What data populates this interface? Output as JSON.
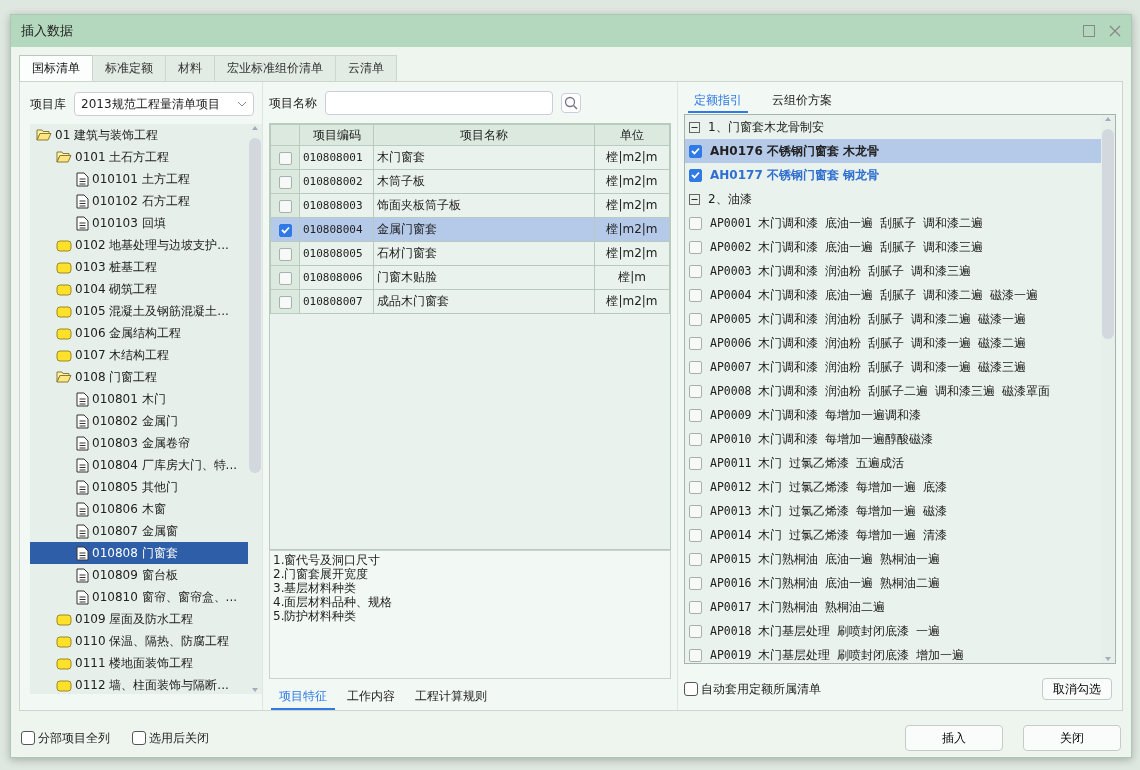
{
  "window": {
    "title": "插入数据"
  },
  "tabs": [
    {
      "label": "国标清单",
      "selected": true
    },
    {
      "label": "标准定额",
      "selected": false
    },
    {
      "label": "材料",
      "selected": false
    },
    {
      "label": "宏业标准组价清单",
      "selected": false
    },
    {
      "label": "云清单",
      "selected": false
    }
  ],
  "library": {
    "label": "项目库",
    "value": "2013规范工程量清单项目"
  },
  "tree": [
    {
      "label": "01 建筑与装饰工程",
      "kind": "folder",
      "expanded": true,
      "selected": false,
      "children": [
        {
          "label": "0101 土石方工程",
          "kind": "folder",
          "expanded": true,
          "selected": false,
          "children": [
            {
              "label": "010101 土方工程",
              "kind": "doc",
              "selected": false
            },
            {
              "label": "010102 石方工程",
              "kind": "doc",
              "selected": false
            },
            {
              "label": "010103 回填",
              "kind": "doc",
              "selected": false
            }
          ]
        },
        {
          "label": "0102 地基处理与边坡支护...",
          "kind": "folder",
          "expanded": false,
          "selected": false
        },
        {
          "label": "0103 桩基工程",
          "kind": "folder",
          "expanded": false,
          "selected": false
        },
        {
          "label": "0104 砌筑工程",
          "kind": "folder",
          "expanded": false,
          "selected": false
        },
        {
          "label": "0105 混凝土及钢筋混凝土...",
          "kind": "folder",
          "expanded": false,
          "selected": false
        },
        {
          "label": "0106 金属结构工程",
          "kind": "folder",
          "expanded": false,
          "selected": false
        },
        {
          "label": "0107 木结构工程",
          "kind": "folder",
          "expanded": false,
          "selected": false
        },
        {
          "label": "0108 门窗工程",
          "kind": "folder",
          "expanded": true,
          "selected": false,
          "children": [
            {
              "label": "010801 木门",
              "kind": "doc",
              "selected": false
            },
            {
              "label": "010802 金属门",
              "kind": "doc",
              "selected": false
            },
            {
              "label": "010803 金属卷帘",
              "kind": "doc",
              "selected": false
            },
            {
              "label": "010804 厂库房大门、特...",
              "kind": "doc",
              "selected": false
            },
            {
              "label": "010805 其他门",
              "kind": "doc",
              "selected": false
            },
            {
              "label": "010806 木窗",
              "kind": "doc",
              "selected": false
            },
            {
              "label": "010807 金属窗",
              "kind": "doc",
              "selected": false
            },
            {
              "label": "010808 门窗套",
              "kind": "doc",
              "selected": true
            },
            {
              "label": "010809 窗台板",
              "kind": "doc",
              "selected": false
            },
            {
              "label": "010810 窗帘、窗帘盒、...",
              "kind": "doc",
              "selected": false
            }
          ]
        },
        {
          "label": "0109 屋面及防水工程",
          "kind": "folder",
          "expanded": false,
          "selected": false
        },
        {
          "label": "0110 保温、隔热、防腐工程",
          "kind": "folder",
          "expanded": false,
          "selected": false
        },
        {
          "label": "0111 楼地面装饰工程",
          "kind": "folder",
          "expanded": false,
          "selected": false
        },
        {
          "label": "0112 墙、柱面装饰与隔断...",
          "kind": "folder",
          "expanded": false,
          "selected": false
        }
      ]
    }
  ],
  "search": {
    "label": "项目名称"
  },
  "table": {
    "columns": [
      "项目编码",
      "项目名称",
      "单位"
    ],
    "rows": [
      {
        "code": "010808001",
        "name": "木门窗套",
        "unit": "樘|m2|m",
        "checked": false,
        "selected": false
      },
      {
        "code": "010808002",
        "name": "木筒子板",
        "unit": "樘|m2|m",
        "checked": false,
        "selected": false
      },
      {
        "code": "010808003",
        "name": "饰面夹板筒子板",
        "unit": "樘|m2|m",
        "checked": false,
        "selected": false
      },
      {
        "code": "010808004",
        "name": "金属门窗套",
        "unit": "樘|m2|m",
        "checked": true,
        "selected": true
      },
      {
        "code": "010808005",
        "name": "石材门窗套",
        "unit": "樘|m2|m",
        "checked": false,
        "selected": false
      },
      {
        "code": "010808006",
        "name": "门窗木贴脸",
        "unit": "樘|m",
        "checked": false,
        "selected": false
      },
      {
        "code": "010808007",
        "name": "成品木门窗套",
        "unit": "樘|m2|m",
        "checked": false,
        "selected": false
      }
    ]
  },
  "features": [
    "1.窗代号及洞口尺寸",
    "2.门窗套展开宽度",
    "3.基层材料种类",
    "4.面层材料品种、规格",
    "5.防护材料种类"
  ],
  "detail_tabs": [
    {
      "label": "项目特征",
      "selected": true
    },
    {
      "label": "工作内容",
      "selected": false
    },
    {
      "label": "工程计算规则",
      "selected": false
    }
  ],
  "quota_tabs": [
    {
      "label": "定额指引",
      "selected": true
    },
    {
      "label": "云组价方案",
      "selected": false
    }
  ],
  "quota_list": [
    {
      "kind": "group",
      "label": "1、门窗套木龙骨制安",
      "expanded": true
    },
    {
      "kind": "item",
      "label": "AH0176 不锈钢门窗套 木龙骨",
      "checked": true,
      "selected": true
    },
    {
      "kind": "item",
      "label": "AH0177 不锈钢门窗套 钢龙骨",
      "checked": true,
      "selected": false
    },
    {
      "kind": "group",
      "label": "2、油漆",
      "expanded": true
    },
    {
      "kind": "item",
      "label": "AP0001 木门调和漆 底油一遍 刮腻子 调和漆二遍",
      "checked": false,
      "selected": false
    },
    {
      "kind": "item",
      "label": "AP0002 木门调和漆 底油一遍 刮腻子 调和漆三遍",
      "checked": false,
      "selected": false
    },
    {
      "kind": "item",
      "label": "AP0003 木门调和漆 润油粉 刮腻子 调和漆三遍",
      "checked": false,
      "selected": false
    },
    {
      "kind": "item",
      "label": "AP0004 木门调和漆 底油一遍 刮腻子 调和漆二遍 磁漆一遍",
      "checked": false,
      "selected": false
    },
    {
      "kind": "item",
      "label": "AP0005 木门调和漆 润油粉 刮腻子 调和漆二遍 磁漆一遍",
      "checked": false,
      "selected": false
    },
    {
      "kind": "item",
      "label": "AP0006 木门调和漆 润油粉 刮腻子 调和漆一遍 磁漆二遍",
      "checked": false,
      "selected": false
    },
    {
      "kind": "item",
      "label": "AP0007 木门调和漆 润油粉 刮腻子 调和漆一遍 磁漆三遍",
      "checked": false,
      "selected": false
    },
    {
      "kind": "item",
      "label": "AP0008 木门调和漆 润油粉 刮腻子二遍 调和漆三遍 磁漆罩面",
      "checked": false,
      "selected": false
    },
    {
      "kind": "item",
      "label": "AP0009 木门调和漆 每增加一遍调和漆",
      "checked": false,
      "selected": false
    },
    {
      "kind": "item",
      "label": "AP0010 木门调和漆 每增加一遍醇酸磁漆",
      "checked": false,
      "selected": false
    },
    {
      "kind": "item",
      "label": "AP0011 木门 过氯乙烯漆 五遍成活",
      "checked": false,
      "selected": false
    },
    {
      "kind": "item",
      "label": "AP0012 木门 过氯乙烯漆 每增加一遍 底漆",
      "checked": false,
      "selected": false
    },
    {
      "kind": "item",
      "label": "AP0013 木门 过氯乙烯漆 每增加一遍 磁漆",
      "checked": false,
      "selected": false
    },
    {
      "kind": "item",
      "label": "AP0014 木门 过氯乙烯漆 每增加一遍 清漆",
      "checked": false,
      "selected": false
    },
    {
      "kind": "item",
      "label": "AP0015 木门熟桐油 底油一遍 熟桐油一遍",
      "checked": false,
      "selected": false
    },
    {
      "kind": "item",
      "label": "AP0016 木门熟桐油 底油一遍 熟桐油二遍",
      "checked": false,
      "selected": false
    },
    {
      "kind": "item",
      "label": "AP0017 木门熟桐油 熟桐油二遍",
      "checked": false,
      "selected": false
    },
    {
      "kind": "item",
      "label": "AP0018 木门基层处理 刷喷封闭底漆 一遍",
      "checked": false,
      "selected": false
    },
    {
      "kind": "item",
      "label": "AP0019 木门基层处理 刷喷封闭底漆 增加一遍",
      "checked": false,
      "selected": false
    }
  ],
  "auto_apply": {
    "label": "自动套用定额所属清单",
    "checked": false
  },
  "clear_button": "取消勾选",
  "options": [
    {
      "label": "分部项目全列",
      "checked": false
    },
    {
      "label": "选用后关闭",
      "checked": false
    }
  ],
  "buttons": [
    "插入",
    "关闭"
  ]
}
